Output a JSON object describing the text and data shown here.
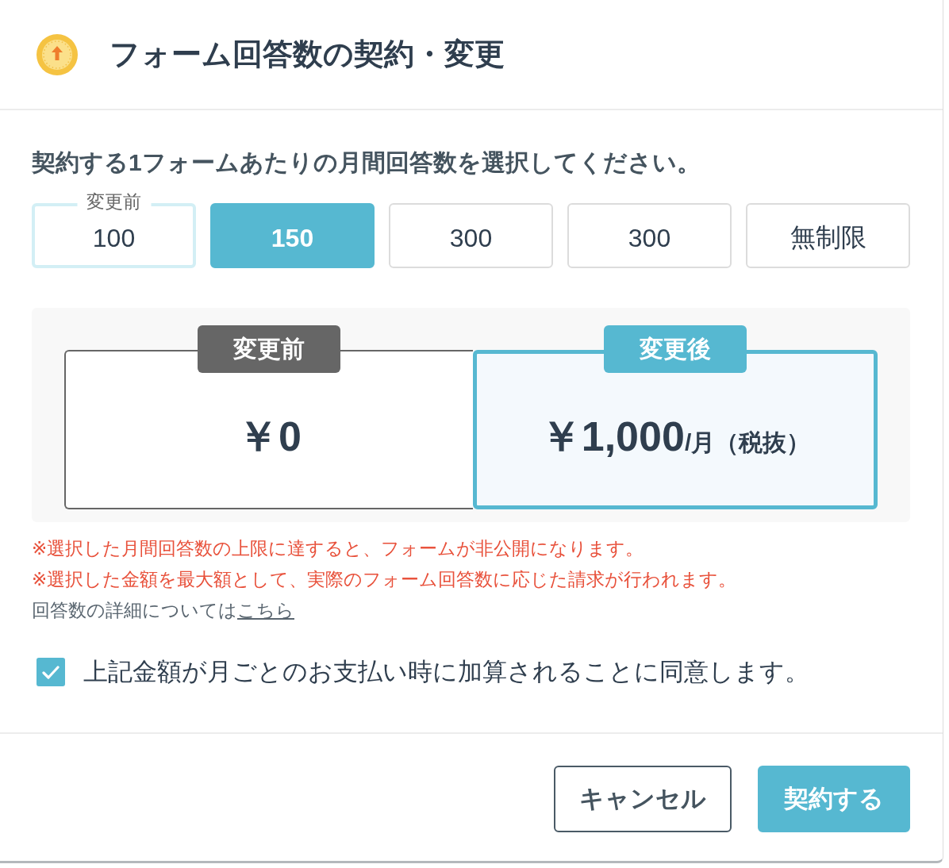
{
  "dialog": {
    "title": "フォーム回答数の契約・変更"
  },
  "prompt": "契約する1フォームあたりの月間回答数を選択してください。",
  "options": [
    {
      "label": "100",
      "tag": "変更前",
      "current": true,
      "selected": false
    },
    {
      "label": "150",
      "current": false,
      "selected": true
    },
    {
      "label": "300",
      "current": false,
      "selected": false
    },
    {
      "label": "300",
      "current": false,
      "selected": false
    },
    {
      "label": "無制限",
      "current": false,
      "selected": false
    }
  ],
  "panels": [
    {
      "kind": "before",
      "tag": "変更前",
      "amount": "￥0"
    },
    {
      "kind": "after",
      "tag": "変更後",
      "amount": "￥1,000",
      "unit": "/月",
      "note": "（税抜）"
    }
  ],
  "notes": [
    {
      "kind": "warning",
      "text": "※選択した月間回答数の上限に達すると、フォームが非公開になります。"
    },
    {
      "kind": "warning",
      "text": "※選択した金額を最大額として、実際のフォーム回答数に応じた請求が行われます。"
    }
  ],
  "detail": {
    "text": "回答数の詳細については",
    "link": "こちら"
  },
  "agreement": {
    "checked": true,
    "label": "上記金額が月ごとのお支払い時に加算されることに同意します。"
  },
  "buttons": [
    {
      "kind": "secondary",
      "label": "キャンセル"
    },
    {
      "kind": "primary",
      "label": "契約する"
    }
  ]
}
